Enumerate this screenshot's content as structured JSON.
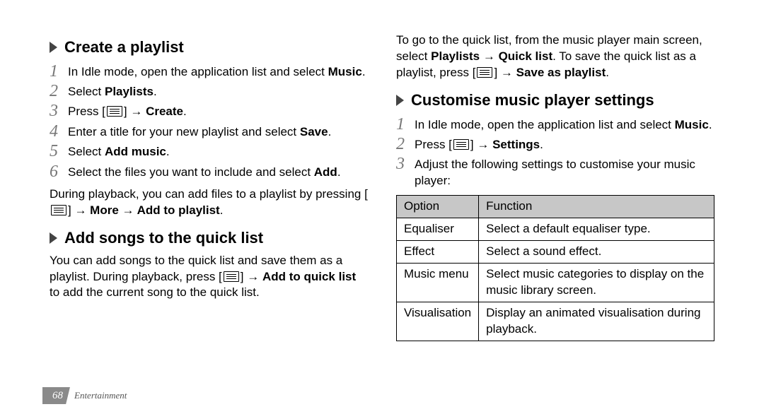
{
  "footer": {
    "page": "68",
    "section": "Entertainment"
  },
  "left": {
    "h1": "Create a playlist",
    "steps1": [
      {
        "pre": "In Idle mode, open the application list and select ",
        "bold": "Music",
        "post": "."
      },
      {
        "pre": "Select ",
        "bold": "Playlists",
        "post": "."
      },
      {
        "pre": "Press [",
        "icon": true,
        "post1": "] → ",
        "bold": "Create",
        "post2": "."
      },
      {
        "pre": "Enter a title for your new playlist and select ",
        "bold": "Save",
        "post": "."
      },
      {
        "pre": "Select ",
        "bold": "Add music",
        "post": "."
      },
      {
        "pre": "Select the files you want to include and select ",
        "bold": "Add",
        "post": "."
      }
    ],
    "para1_pre": "During playback, you can add files to a playlist by pressing [",
    "para1_post": "] → ",
    "para1_bold": "More → Add to playlist",
    "para1_end": ".",
    "h2": "Add songs to the quick list",
    "para2_pre": "You can add songs to the quick list and save them as a playlist. During playback, press [",
    "para2_mid": "] → ",
    "para2_bold": "Add to quick list",
    "para2_post": " to add the current song to the quick list."
  },
  "right": {
    "intro_pre": "To go to the quick list, from the music player main screen, select ",
    "intro_bold1": "Playlists → Quick list",
    "intro_mid": ". To save the quick list as a playlist, press [",
    "intro_post": "] → ",
    "intro_bold2": "Save as playlist",
    "intro_end": ".",
    "h3": "Customise music player settings",
    "steps2": [
      {
        "pre": "In Idle mode, open the application list and select ",
        "bold": "Music",
        "post": "."
      },
      {
        "pre": "Press [",
        "icon": true,
        "post1": "] → ",
        "bold": "Settings",
        "post2": "."
      },
      {
        "pre": "Adjust the following settings to customise your music player:"
      }
    ],
    "table": {
      "head": {
        "c1": "Option",
        "c2": "Function"
      },
      "rows": [
        {
          "c1": "Equaliser",
          "c2": "Select a default equaliser type."
        },
        {
          "c1": "Effect",
          "c2": "Select a sound effect."
        },
        {
          "c1": "Music menu",
          "c2": "Select music categories to display on the music library screen."
        },
        {
          "c1": "Visualisation",
          "c2": "Display an animated visualisation during playback."
        }
      ]
    }
  }
}
